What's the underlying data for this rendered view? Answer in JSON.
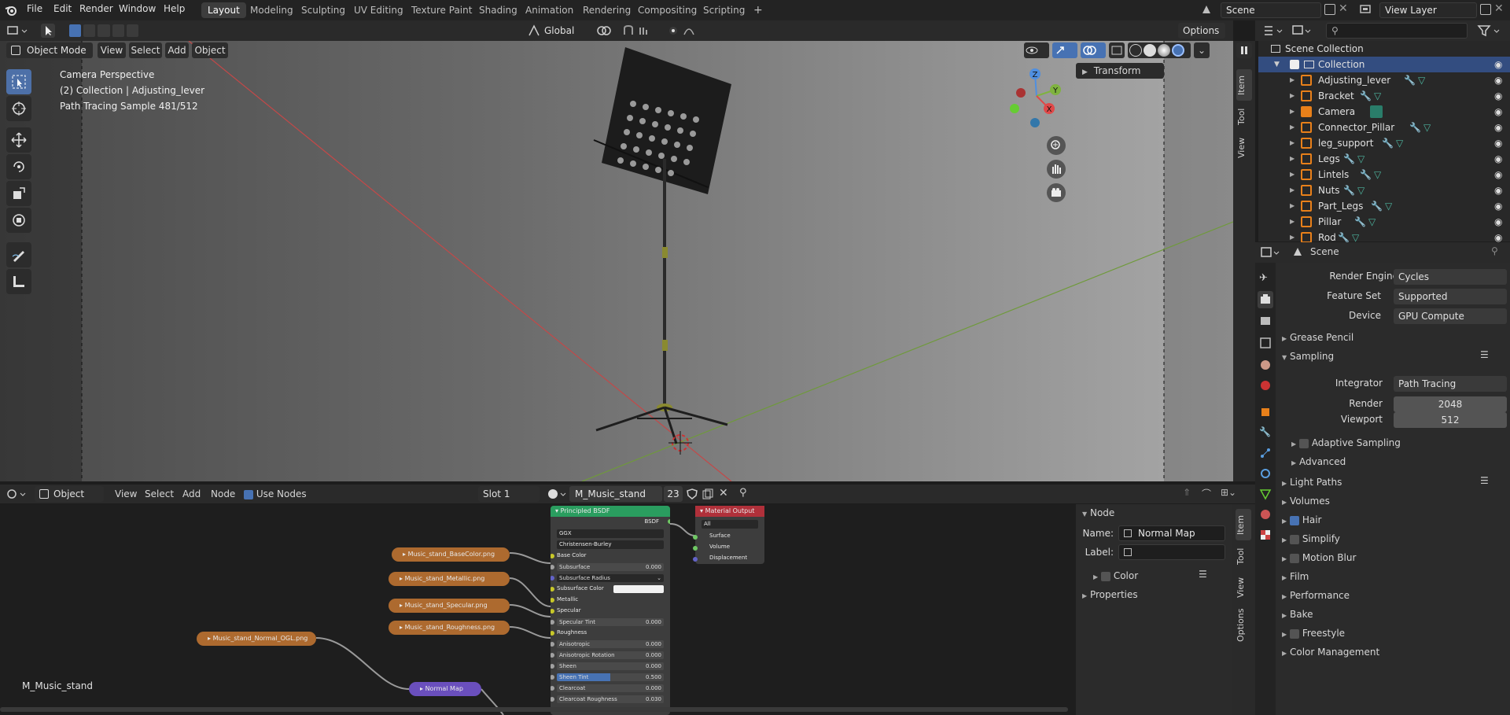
{
  "topbar": {
    "menus": [
      "File",
      "Edit",
      "Render",
      "Window",
      "Help"
    ],
    "workspaces": [
      "Layout",
      "Modeling",
      "Sculpting",
      "UV Editing",
      "Texture Paint",
      "Shading",
      "Animation",
      "Rendering",
      "Compositing",
      "Scripting"
    ],
    "active_workspace": "Layout",
    "add_workspace": "+",
    "scene_name": "Scene",
    "view_layer": "View Layer"
  },
  "viewport_header": {
    "mode": "Object Mode",
    "menus": [
      "View",
      "Select",
      "Add",
      "Object"
    ],
    "orientation": "Global",
    "options": "Options"
  },
  "viewport": {
    "line1": "Camera Perspective",
    "line2": "(2) Collection | Adjusting_lever",
    "line3": "Path Tracing Sample 481/512",
    "transform_panel": "Transform",
    "side_tabs": [
      "Item",
      "Tool",
      "View"
    ],
    "gizmo": {
      "x": "X",
      "y": "Y",
      "z": "Z"
    }
  },
  "outliner": {
    "search_placeholder": "",
    "root": "Scene Collection",
    "collection": "Collection",
    "items": [
      "Adjusting_lever",
      "Bracket",
      "Camera",
      "Connector_Pillar",
      "leg_support",
      "Legs",
      "Lintels",
      "Nuts",
      "Part_Legs",
      "Pillar",
      "Rod"
    ]
  },
  "properties": {
    "context": "Scene",
    "render_engine_label": "Render Engine",
    "render_engine": "Cycles",
    "feature_set_label": "Feature Set",
    "feature_set": "Supported",
    "device_label": "Device",
    "device": "GPU Compute",
    "sections": {
      "grease_pencil": "Grease Pencil",
      "sampling": "Sampling",
      "integrator_label": "Integrator",
      "integrator": "Path Tracing",
      "render_label": "Render",
      "render_value": "2048",
      "viewport_label": "Viewport",
      "viewport_value": "512",
      "adaptive_sampling": "Adaptive Sampling",
      "advanced": "Advanced",
      "light_paths": "Light Paths",
      "volumes": "Volumes",
      "hair": "Hair",
      "simplify": "Simplify",
      "motion_blur": "Motion Blur",
      "film": "Film",
      "performance": "Performance",
      "bake": "Bake",
      "freestyle": "Freestyle",
      "color_management": "Color Management"
    }
  },
  "node_header": {
    "editor": "Object",
    "menus": [
      "View",
      "Select",
      "Add",
      "Node"
    ],
    "use_nodes": "Use Nodes",
    "slot": "Slot 1",
    "material": "M_Music_stand",
    "users": "23"
  },
  "node_editor": {
    "material_label": "M_Music_stand",
    "images": [
      "Music_stand_BaseColor.png",
      "Music_stand_Metallic.png",
      "Music_stand_Specular.png",
      "Music_stand_Roughness.png",
      "Music_stand_Normal_OGL.png"
    ],
    "normal_map": "Normal Map",
    "bsdf": {
      "title": "Principled BSDF",
      "output": "BSDF",
      "distribution": "GGX",
      "subsurface_method": "Christensen-Burley",
      "rows": [
        {
          "label": "Base Color",
          "value": "",
          "kind": "socket"
        },
        {
          "label": "Subsurface",
          "value": "0.000",
          "kind": "bar"
        },
        {
          "label": "Subsurface Radius",
          "value": "",
          "kind": "dd"
        },
        {
          "label": "Subsurface Color",
          "value": "",
          "kind": "color"
        },
        {
          "label": "Metallic",
          "value": "",
          "kind": "socket"
        },
        {
          "label": "Specular",
          "value": "",
          "kind": "socket"
        },
        {
          "label": "Specular Tint",
          "value": "0.000",
          "kind": "bar"
        },
        {
          "label": "Roughness",
          "value": "",
          "kind": "socket"
        },
        {
          "label": "Anisotropic",
          "value": "0.000",
          "kind": "bar"
        },
        {
          "label": "Anisotropic Rotation",
          "value": "0.000",
          "kind": "bar"
        },
        {
          "label": "Sheen",
          "value": "0.000",
          "kind": "bar"
        },
        {
          "label": "Sheen Tint",
          "value": "0.500",
          "kind": "barblue"
        },
        {
          "label": "Clearcoat",
          "value": "0.000",
          "kind": "bar"
        },
        {
          "label": "Clearcoat Roughness",
          "value": "0.030",
          "kind": "bar"
        }
      ]
    },
    "output": {
      "title": "Material Output",
      "target": "All",
      "sockets": [
        "Surface",
        "Volume",
        "Displacement"
      ]
    }
  },
  "node_panel": {
    "section": "Node",
    "name_label": "Name:",
    "name_value": "Normal Map",
    "label_label": "Label:",
    "label_value": "",
    "color": "Color",
    "properties": "Properties",
    "side_tabs": [
      "Item",
      "Tool",
      "View",
      "Options"
    ]
  },
  "colors": {
    "accent": "#4772b3",
    "image_node": "#ad6a2f",
    "bsdf_header": "#2a9d5f",
    "output_header": "#b0303a",
    "normal_node": "#6a4fbd"
  }
}
